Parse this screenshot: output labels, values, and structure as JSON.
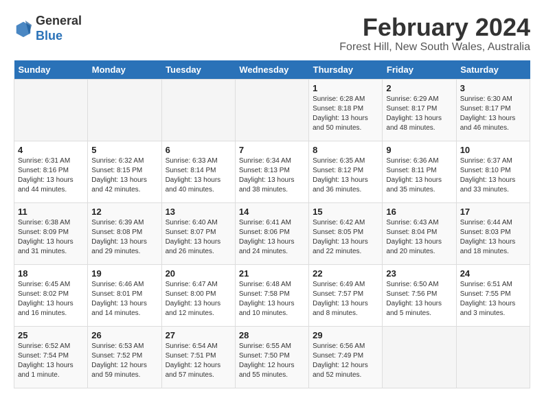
{
  "logo": {
    "general": "General",
    "blue": "Blue"
  },
  "header": {
    "month_year": "February 2024",
    "location": "Forest Hill, New South Wales, Australia"
  },
  "weekdays": [
    "Sunday",
    "Monday",
    "Tuesday",
    "Wednesday",
    "Thursday",
    "Friday",
    "Saturday"
  ],
  "weeks": [
    [
      {
        "day": "",
        "info": ""
      },
      {
        "day": "",
        "info": ""
      },
      {
        "day": "",
        "info": ""
      },
      {
        "day": "",
        "info": ""
      },
      {
        "day": "1",
        "info": "Sunrise: 6:28 AM\nSunset: 8:18 PM\nDaylight: 13 hours\nand 50 minutes."
      },
      {
        "day": "2",
        "info": "Sunrise: 6:29 AM\nSunset: 8:17 PM\nDaylight: 13 hours\nand 48 minutes."
      },
      {
        "day": "3",
        "info": "Sunrise: 6:30 AM\nSunset: 8:17 PM\nDaylight: 13 hours\nand 46 minutes."
      }
    ],
    [
      {
        "day": "4",
        "info": "Sunrise: 6:31 AM\nSunset: 8:16 PM\nDaylight: 13 hours\nand 44 minutes."
      },
      {
        "day": "5",
        "info": "Sunrise: 6:32 AM\nSunset: 8:15 PM\nDaylight: 13 hours\nand 42 minutes."
      },
      {
        "day": "6",
        "info": "Sunrise: 6:33 AM\nSunset: 8:14 PM\nDaylight: 13 hours\nand 40 minutes."
      },
      {
        "day": "7",
        "info": "Sunrise: 6:34 AM\nSunset: 8:13 PM\nDaylight: 13 hours\nand 38 minutes."
      },
      {
        "day": "8",
        "info": "Sunrise: 6:35 AM\nSunset: 8:12 PM\nDaylight: 13 hours\nand 36 minutes."
      },
      {
        "day": "9",
        "info": "Sunrise: 6:36 AM\nSunset: 8:11 PM\nDaylight: 13 hours\nand 35 minutes."
      },
      {
        "day": "10",
        "info": "Sunrise: 6:37 AM\nSunset: 8:10 PM\nDaylight: 13 hours\nand 33 minutes."
      }
    ],
    [
      {
        "day": "11",
        "info": "Sunrise: 6:38 AM\nSunset: 8:09 PM\nDaylight: 13 hours\nand 31 minutes."
      },
      {
        "day": "12",
        "info": "Sunrise: 6:39 AM\nSunset: 8:08 PM\nDaylight: 13 hours\nand 29 minutes."
      },
      {
        "day": "13",
        "info": "Sunrise: 6:40 AM\nSunset: 8:07 PM\nDaylight: 13 hours\nand 26 minutes."
      },
      {
        "day": "14",
        "info": "Sunrise: 6:41 AM\nSunset: 8:06 PM\nDaylight: 13 hours\nand 24 minutes."
      },
      {
        "day": "15",
        "info": "Sunrise: 6:42 AM\nSunset: 8:05 PM\nDaylight: 13 hours\nand 22 minutes."
      },
      {
        "day": "16",
        "info": "Sunrise: 6:43 AM\nSunset: 8:04 PM\nDaylight: 13 hours\nand 20 minutes."
      },
      {
        "day": "17",
        "info": "Sunrise: 6:44 AM\nSunset: 8:03 PM\nDaylight: 13 hours\nand 18 minutes."
      }
    ],
    [
      {
        "day": "18",
        "info": "Sunrise: 6:45 AM\nSunset: 8:02 PM\nDaylight: 13 hours\nand 16 minutes."
      },
      {
        "day": "19",
        "info": "Sunrise: 6:46 AM\nSunset: 8:01 PM\nDaylight: 13 hours\nand 14 minutes."
      },
      {
        "day": "20",
        "info": "Sunrise: 6:47 AM\nSunset: 8:00 PM\nDaylight: 13 hours\nand 12 minutes."
      },
      {
        "day": "21",
        "info": "Sunrise: 6:48 AM\nSunset: 7:58 PM\nDaylight: 13 hours\nand 10 minutes."
      },
      {
        "day": "22",
        "info": "Sunrise: 6:49 AM\nSunset: 7:57 PM\nDaylight: 13 hours\nand 8 minutes."
      },
      {
        "day": "23",
        "info": "Sunrise: 6:50 AM\nSunset: 7:56 PM\nDaylight: 13 hours\nand 5 minutes."
      },
      {
        "day": "24",
        "info": "Sunrise: 6:51 AM\nSunset: 7:55 PM\nDaylight: 13 hours\nand 3 minutes."
      }
    ],
    [
      {
        "day": "25",
        "info": "Sunrise: 6:52 AM\nSunset: 7:54 PM\nDaylight: 13 hours\nand 1 minute."
      },
      {
        "day": "26",
        "info": "Sunrise: 6:53 AM\nSunset: 7:52 PM\nDaylight: 12 hours\nand 59 minutes."
      },
      {
        "day": "27",
        "info": "Sunrise: 6:54 AM\nSunset: 7:51 PM\nDaylight: 12 hours\nand 57 minutes."
      },
      {
        "day": "28",
        "info": "Sunrise: 6:55 AM\nSunset: 7:50 PM\nDaylight: 12 hours\nand 55 minutes."
      },
      {
        "day": "29",
        "info": "Sunrise: 6:56 AM\nSunset: 7:49 PM\nDaylight: 12 hours\nand 52 minutes."
      },
      {
        "day": "",
        "info": ""
      },
      {
        "day": "",
        "info": ""
      }
    ]
  ]
}
